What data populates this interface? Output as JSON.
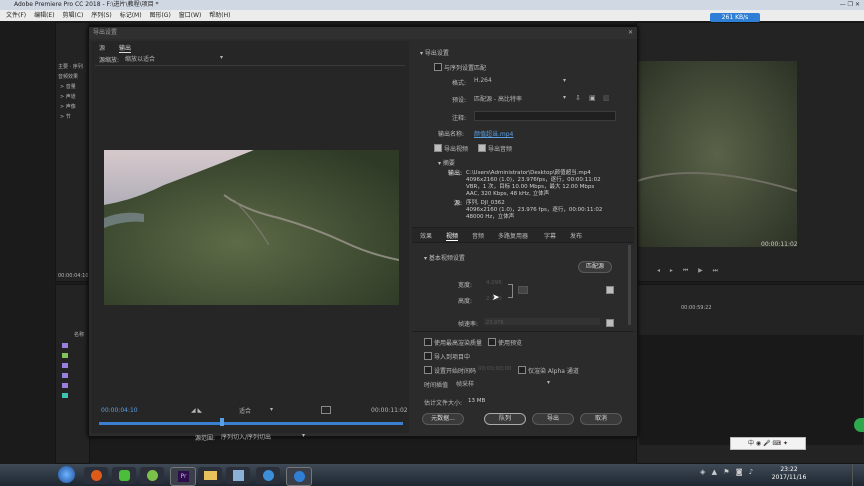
{
  "window": {
    "title": "Adobe Premiere Pro CC 2018 - F:\\进片\\教程\\项目 *"
  },
  "menu": [
    "文件(F)",
    "编辑(E)",
    "剪辑(C)",
    "序列(S)",
    "标记(M)",
    "图形(G)",
    "窗口(W)",
    "帮助(H)"
  ],
  "net_speed": "261 KB/s",
  "bg": {
    "left_labels": [
      "主要 · 序列",
      "音频效果"
    ],
    "left_tree": [
      "> 音量",
      "> 声道",
      "> 声像",
      "> 节"
    ],
    "timecode_left": "00:00:04:10",
    "name_col": "名称",
    "program_timecode": "00:00:11:02",
    "program_timecode2": "00:00:59:22"
  },
  "dialog": {
    "title": "导出设置",
    "tabs": [
      "源",
      "输出"
    ],
    "scale_label": "源缩放:",
    "scale_value": "缩放以适合",
    "timecode_current": "00:00:04:10",
    "fit_value": "适合",
    "timecode_end": "00:00:11:02",
    "range_label": "源范围:",
    "range_value": "序列切入/序列切出",
    "export_settings": {
      "header": "导出设置",
      "match_sequence": "与序列设置匹配",
      "format_label": "格式:",
      "format_value": "H.264",
      "preset_label": "预设:",
      "preset_value": "匹配源 - 高比特率",
      "comment_label": "注释:",
      "output_name_label": "输出名称:",
      "output_name_value": "颜值超当.mp4",
      "export_video": "导出视频",
      "export_audio": "导出音频"
    },
    "summary": {
      "header": "摘要",
      "output_label": "输出:",
      "output_lines": [
        "C:\\Users\\Administrator\\Desktop\\颜值超当.mp4",
        "4096x2160 (1.0)，23.976fps，逐行，00:00:11:02",
        "VBR，1 次，目标 10.00 Mbps，最大 12.00 Mbps",
        "AAC, 320 Kbps, 48 kHz, 立体声"
      ],
      "source_label": "源:",
      "source_lines": [
        "序列, DJI_0362",
        "4096x2160 (1.0)，23.976 fps，逐行，00:00:11:02",
        "48000 Hz，立体声"
      ]
    },
    "right_tabs": [
      "效果",
      "视频",
      "音频",
      "多路复用器",
      "字幕",
      "发布"
    ],
    "video": {
      "header": "基本视频设置",
      "match_source": "匹配源",
      "width_label": "宽度:",
      "width_value": "4,096",
      "height_label": "高度:",
      "height_value": "2,160",
      "framerate_label": "帧速率:",
      "framerate_value": "23.976"
    },
    "options": {
      "max_render": "使用最高渲染质量",
      "use_preview": "使用预览",
      "import_project": "导入到项目中",
      "set_start_tc": "设置开始时间码",
      "start_tc_value": "00;00;00;00",
      "render_alpha": "仅渲染 Alpha 通道",
      "interp_label": "时间插值",
      "interp_value": "帧采样",
      "filesize_label": "估计文件大小:",
      "filesize_value": "13 MB"
    },
    "buttons": {
      "metadata": "元数据...",
      "queue": "队列",
      "export": "导出",
      "cancel": "取消"
    }
  },
  "clock": {
    "time": "23:22",
    "date": "2017/11/16"
  }
}
